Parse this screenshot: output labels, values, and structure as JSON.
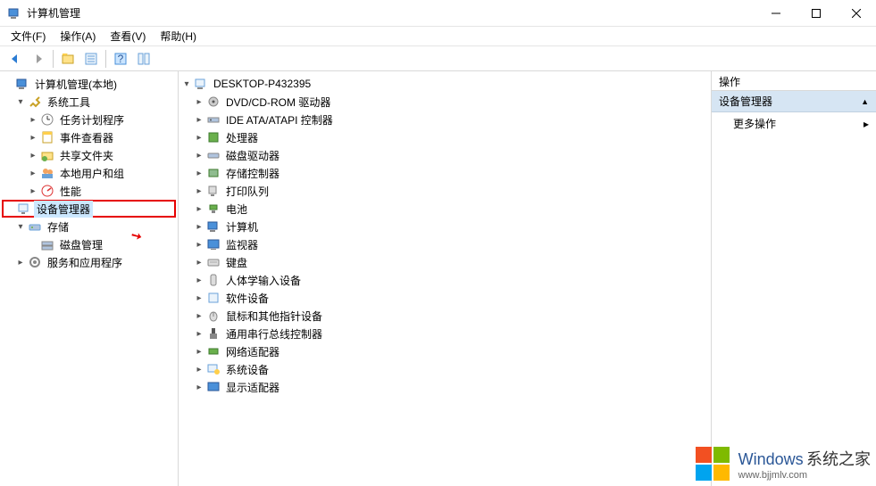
{
  "window": {
    "title": "计算机管理"
  },
  "menubar": [
    {
      "label": "文件(F)"
    },
    {
      "label": "操作(A)"
    },
    {
      "label": "查看(V)"
    },
    {
      "label": "帮助(H)"
    }
  ],
  "left_tree": {
    "root": "计算机管理(本地)",
    "sys_tools": "系统工具",
    "task_sched": "任务计划程序",
    "event_viewer": "事件查看器",
    "shared": "共享文件夹",
    "local_users": "本地用户和组",
    "perf": "性能",
    "device_mgr": "设备管理器",
    "storage": "存储",
    "disk_mgmt": "磁盘管理",
    "services": "服务和应用程序"
  },
  "device_tree": {
    "root": "DESKTOP-P432395",
    "items": [
      "DVD/CD-ROM 驱动器",
      "IDE ATA/ATAPI 控制器",
      "处理器",
      "磁盘驱动器",
      "存储控制器",
      "打印队列",
      "电池",
      "计算机",
      "监视器",
      "键盘",
      "人体学输入设备",
      "软件设备",
      "鼠标和其他指针设备",
      "通用串行总线控制器",
      "网络适配器",
      "系统设备",
      "显示适配器"
    ]
  },
  "actions": {
    "header": "操作",
    "section": "设备管理器",
    "more": "更多操作"
  },
  "watermark": {
    "brand": "Windows",
    "sub1": "系统之家",
    "url": "www.bjjmlv.com"
  }
}
